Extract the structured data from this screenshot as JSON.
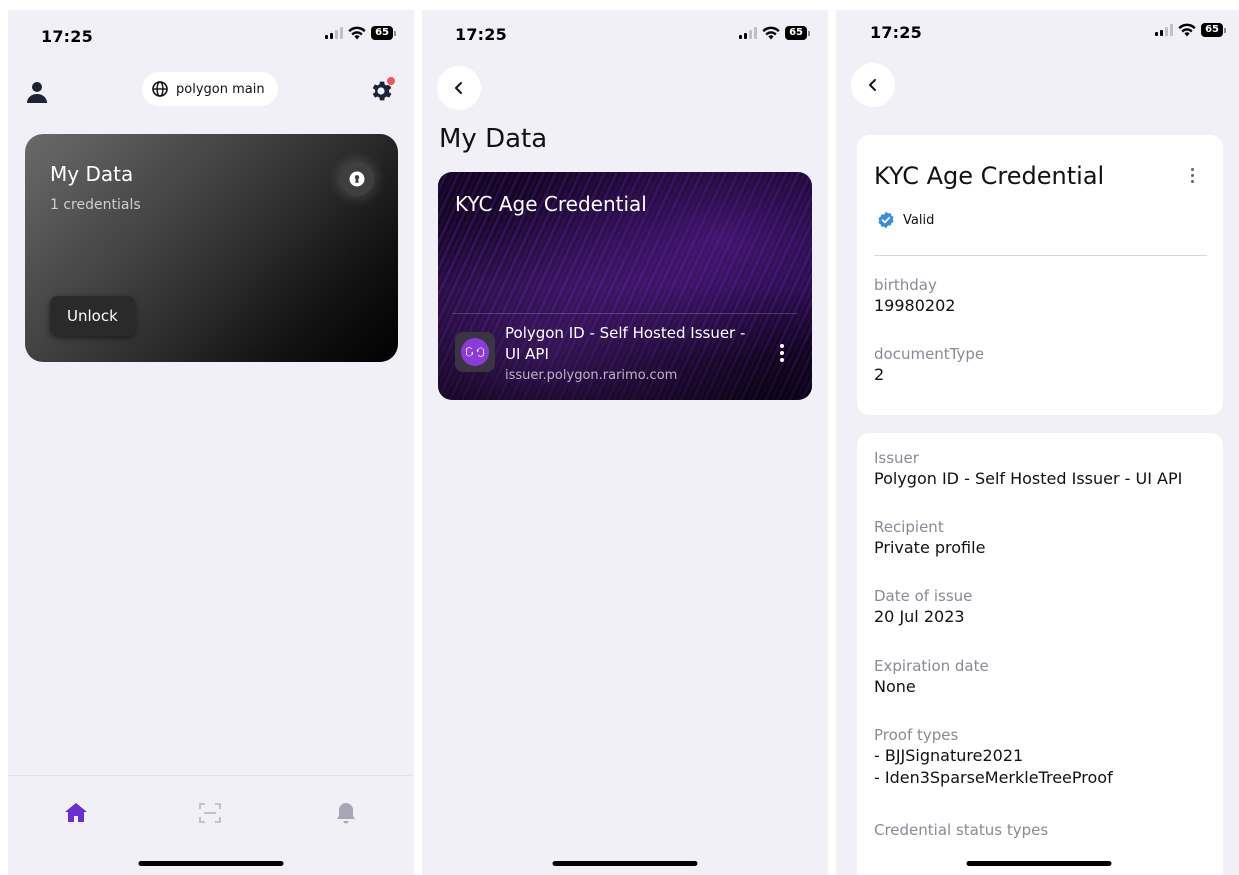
{
  "status_bar": {
    "time": "17:25",
    "battery": "65"
  },
  "screen_home": {
    "network": "polygon main",
    "card": {
      "title": "My Data",
      "subtitle": "1 credentials",
      "unlock_label": "Unlock"
    },
    "nav": {
      "active_color": "#6b2fd1",
      "items": [
        "home-icon",
        "scan-icon",
        "bell-icon"
      ]
    }
  },
  "screen_list": {
    "title": "My Data",
    "credential": {
      "title": "KYC Age Credential",
      "issuer_name": "Polygon ID - Self Hosted Issuer - UI API",
      "issuer_url": "issuer.polygon.rarimo.com"
    }
  },
  "screen_detail": {
    "title": "KYC Age Credential",
    "status": "Valid",
    "fields": [
      {
        "label": "birthday",
        "value": "19980202"
      },
      {
        "label": "documentType",
        "value": "2"
      }
    ],
    "info": [
      {
        "label": "Issuer",
        "value": "Polygon ID - Self Hosted Issuer - UI API"
      },
      {
        "label": "Recipient",
        "value": "Private profile"
      },
      {
        "label": "Date of issue",
        "value": "20 Jul 2023"
      },
      {
        "label": "Expiration date",
        "value": "None"
      },
      {
        "label": "Proof types",
        "value_lines": [
          "- BJJSignature2021",
          "- Iden3SparseMerkleTreeProof"
        ]
      },
      {
        "label": "Credential status types"
      }
    ]
  },
  "colors": {
    "background": "#f0f0f6",
    "accent": "#6b2fd1",
    "valid_badge": "#3a8be8",
    "notification_dot": "#f0545c"
  }
}
